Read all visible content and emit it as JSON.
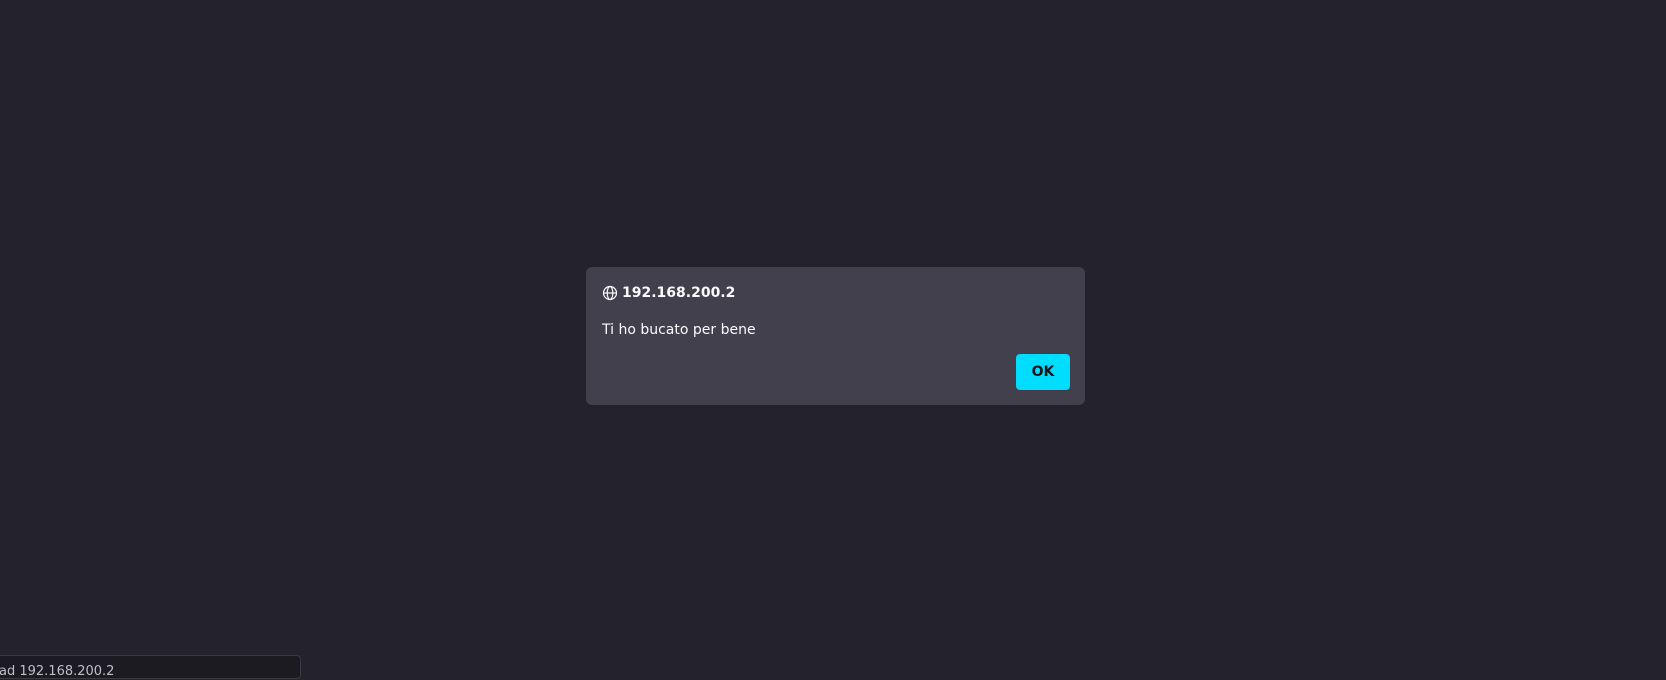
{
  "dialog": {
    "title": "192.168.200.2",
    "title_icon": "globe-icon",
    "message": "Ti ho bucato per bene",
    "ok_label": "OK"
  },
  "status_bar": {
    "text": "ad 192.168.200.2"
  },
  "colors": {
    "page_background": "#24232d",
    "dialog_background": "#42404c",
    "accent_button": "#00ddff",
    "text": "#fbfbfe"
  }
}
